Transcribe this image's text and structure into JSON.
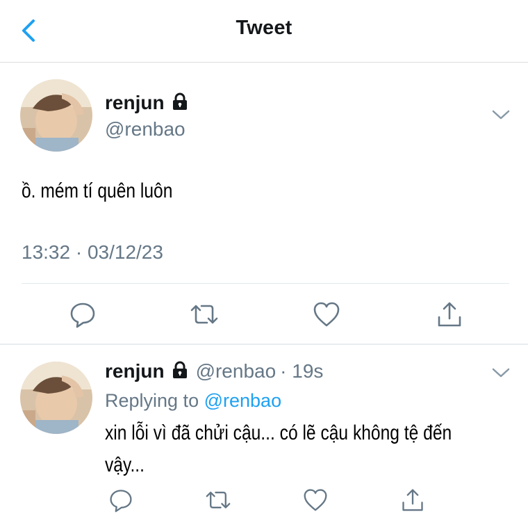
{
  "header": {
    "title": "Tweet",
    "back_icon": "chevron-left-icon"
  },
  "main_tweet": {
    "display_name": "renjun",
    "protected_icon": "lock-icon",
    "handle": "@renbao",
    "text": "ồ. mém tí quên luôn",
    "timestamp": "13:32 · 03/12/23"
  },
  "actions": [
    "reply-icon",
    "retweet-icon",
    "like-icon",
    "share-icon"
  ],
  "reply_tweet": {
    "display_name": "renjun",
    "handle": "@renbao",
    "time": "· 19s",
    "replying_label": "Replying to",
    "replying_to": "@renbao",
    "text": "xin lỗi vì đã chửi cậu... có lẽ cậu không tệ đến vậy..."
  },
  "colors": {
    "accent": "#1da1f2",
    "secondary_text": "#657786",
    "divider": "#e1e8ed"
  }
}
